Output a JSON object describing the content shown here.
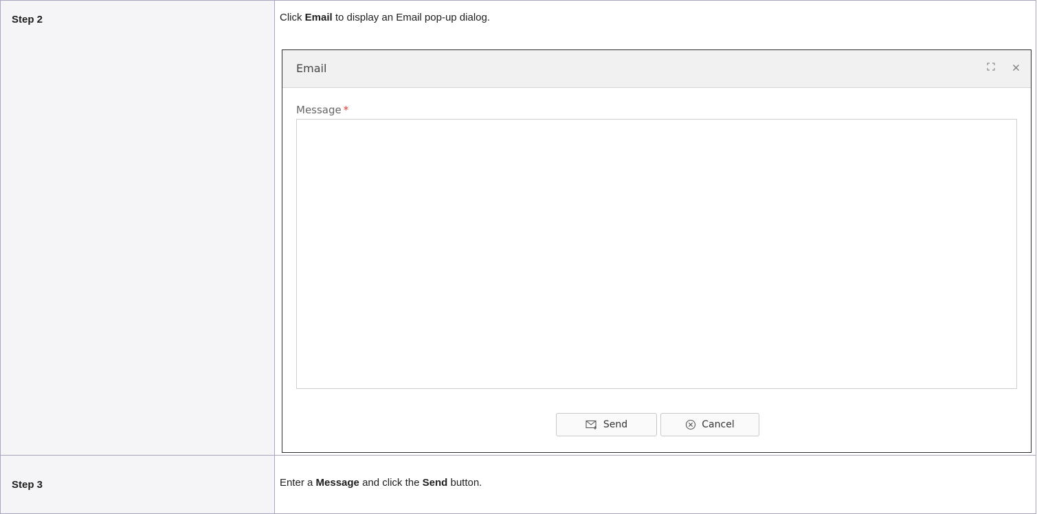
{
  "rows": [
    {
      "step": "Step 2",
      "desc_before": "Click ",
      "desc_bold": "Email",
      "desc_after": " to display an Email pop-up dialog."
    },
    {
      "step": "Step 3",
      "desc_before": "Enter a ",
      "desc_bold1": "Message",
      "desc_mid": " and click the ",
      "desc_bold2": "Send",
      "desc_after": " button."
    }
  ],
  "dialog": {
    "title": "Email",
    "message_label": "Message",
    "required_mark": "*",
    "message_value": "",
    "send_label": "Send",
    "cancel_label": "Cancel",
    "icons": {
      "maximize": "maximize-icon",
      "close": "close-icon",
      "send": "mail-send-icon",
      "cancel": "circle-x-icon"
    }
  },
  "colors": {
    "table_border": "#a6a6bf",
    "step_column_bg": "#f5f5f8",
    "dialog_header_bg": "#f1f1f1",
    "required": "#e53935"
  }
}
